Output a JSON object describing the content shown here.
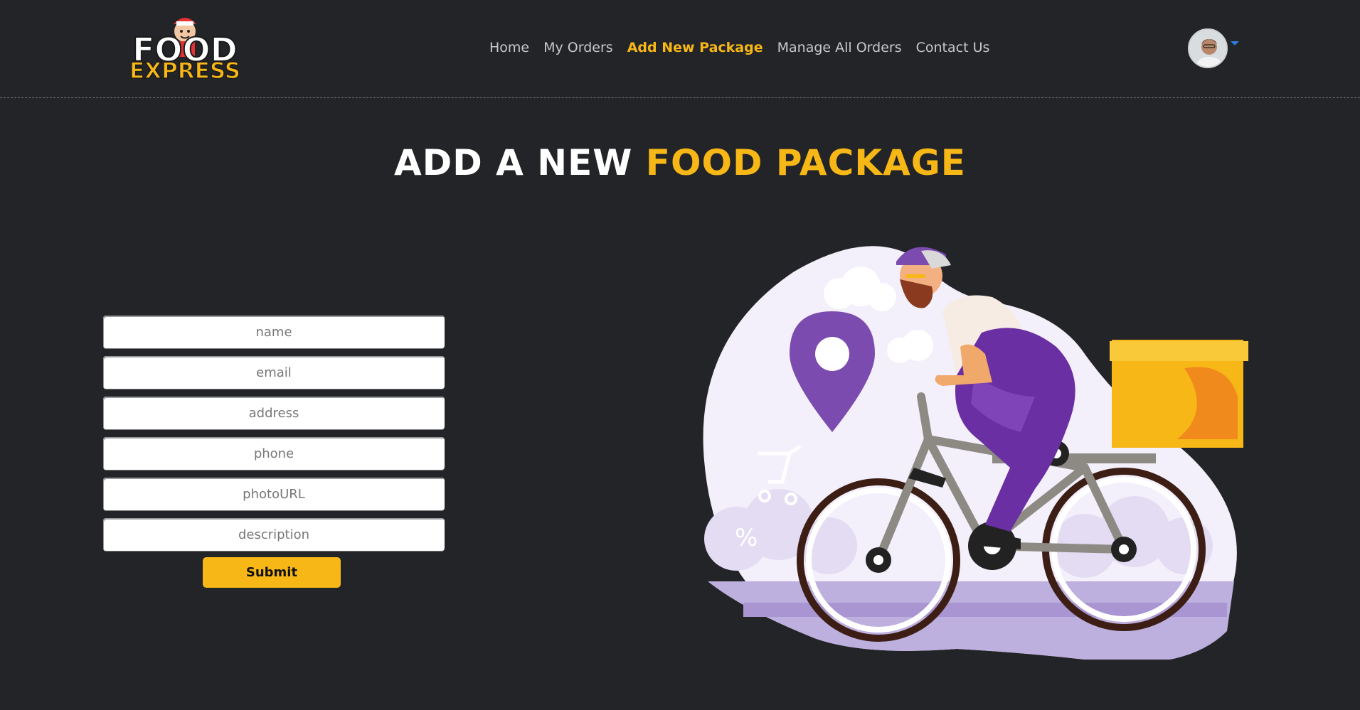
{
  "logo": {
    "line1": "FOOD",
    "line2": "EXPRESS"
  },
  "nav": {
    "items": [
      {
        "label": "Home",
        "active": false
      },
      {
        "label": "My Orders",
        "active": false
      },
      {
        "label": "Add New Package",
        "active": true
      },
      {
        "label": "Manage All Orders",
        "active": false
      },
      {
        "label": "Contact Us",
        "active": false
      }
    ]
  },
  "title": {
    "part1": "ADD A NEW ",
    "part2": "FOOD PACKAGE"
  },
  "form": {
    "fields": [
      {
        "placeholder": "name",
        "value": ""
      },
      {
        "placeholder": "email",
        "value": ""
      },
      {
        "placeholder": "address",
        "value": ""
      },
      {
        "placeholder": "phone",
        "value": ""
      },
      {
        "placeholder": "photoURL",
        "value": ""
      },
      {
        "placeholder": "description",
        "value": ""
      }
    ],
    "submit_label": "Submit"
  },
  "colors": {
    "accent": "#f7b716",
    "background": "#232427",
    "nav_text": "#c9c9cc"
  },
  "icons": {
    "caret": "caret-down-icon",
    "avatar": "user-avatar"
  }
}
